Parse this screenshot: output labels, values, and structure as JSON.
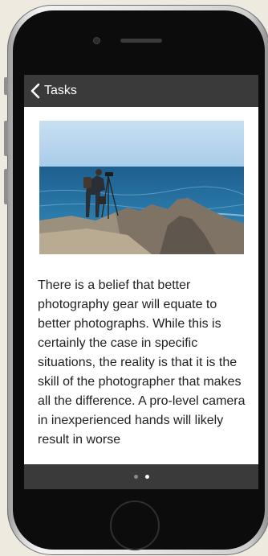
{
  "nav": {
    "back_label": "Tasks"
  },
  "article": {
    "body": "There is a belief that better photography gear will equate to better photographs. While this is certainly the case in specific situations, the reality is that it is the skill of the photographer that makes all the difference. A pro-level camera in inexperienced hands will likely result in worse"
  },
  "pager": {
    "total": 2,
    "current": 1
  },
  "colors": {
    "bar": "#3a3a3a",
    "dot_inactive": "#8a8a8a",
    "dot_active": "#ffffff",
    "background": "#efeae0"
  },
  "icons": {
    "back": "chevron-left-icon"
  }
}
